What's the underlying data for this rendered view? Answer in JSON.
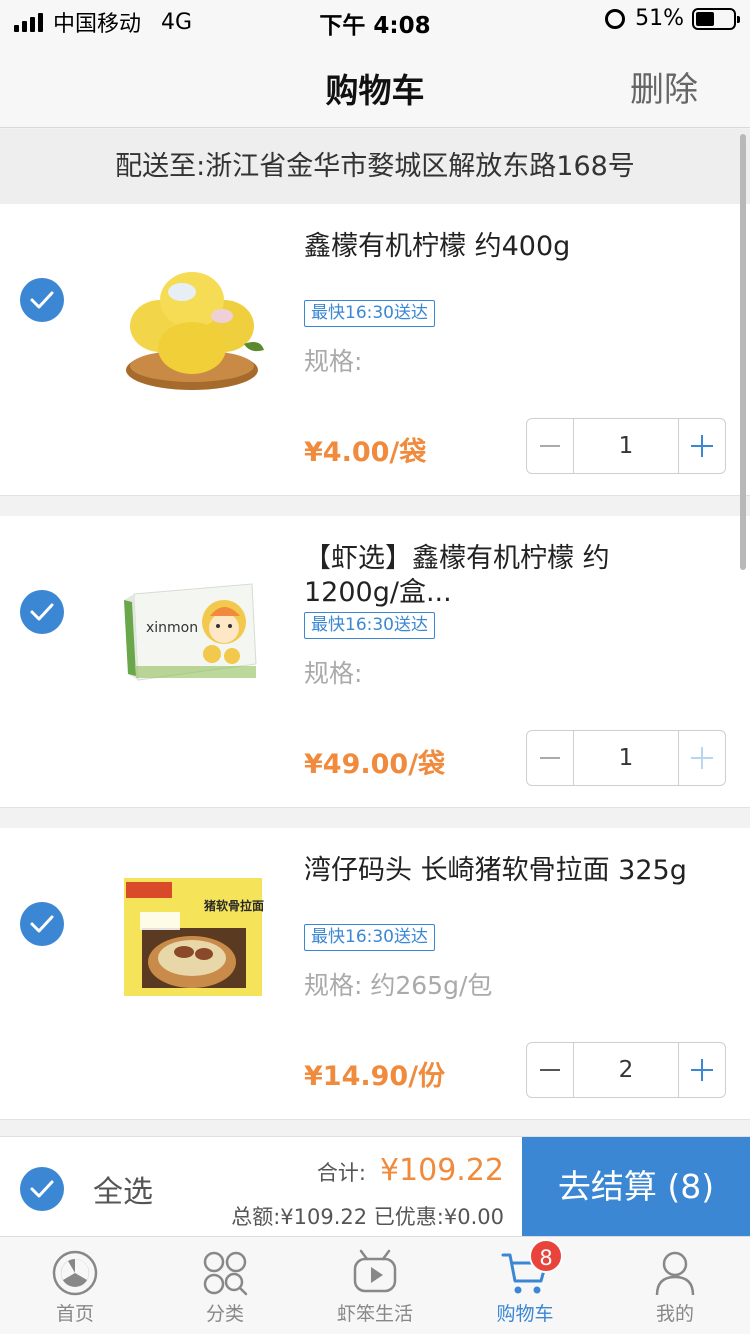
{
  "status_bar": {
    "carrier": "中国移动",
    "network": "4G",
    "time": "下午 4:08",
    "battery_percent": "51%",
    "battery_level": 0.51
  },
  "nav": {
    "title": "购物车",
    "delete_label": "删除"
  },
  "address": {
    "text": "配送至:浙江省金华市婺城区解放东路168号"
  },
  "items": [
    {
      "name": "鑫檬有机柠檬 约400g",
      "badge": "最快16:30送达",
      "spec": "规格:",
      "price": "¥4.00/袋",
      "qty": "1",
      "checked": true,
      "plus_enabled": true,
      "thumb_icon": "lemon-image"
    },
    {
      "name": "【虾选】鑫檬有机柠檬 约1200g/盒...",
      "badge": "最快16:30送达",
      "spec": "规格:",
      "price": "¥49.00/袋",
      "qty": "1",
      "checked": true,
      "plus_enabled": false,
      "thumb_icon": "lemon-box-image",
      "thumb_text": "xinmon"
    },
    {
      "name": "湾仔码头 长崎猪软骨拉面 325g",
      "badge": "最快16:30送达",
      "spec": "规格: 约265g/包",
      "price": "¥14.90/份",
      "qty": "2",
      "checked": true,
      "plus_enabled": true,
      "thumb_icon": "ramen-package-image",
      "thumb_text": "猪软骨拉面"
    }
  ],
  "checkout": {
    "select_all_label": "全选",
    "total_label": "合计:",
    "total_amount": "¥109.22",
    "summary": "总额:¥109.22 已优惠:¥0.00",
    "button_label": "去结算 (8)"
  },
  "tabs": [
    {
      "label": "首页",
      "icon": "home-icon"
    },
    {
      "label": "分类",
      "icon": "category-icon"
    },
    {
      "label": "虾笨生活",
      "icon": "video-icon"
    },
    {
      "label": "购物车",
      "icon": "cart-icon",
      "active": true,
      "badge": "8"
    },
    {
      "label": "我的",
      "icon": "profile-icon"
    }
  ],
  "colors": {
    "accent": "#3b87d4",
    "price": "#f08a3c",
    "badge_red": "#e8443b"
  }
}
